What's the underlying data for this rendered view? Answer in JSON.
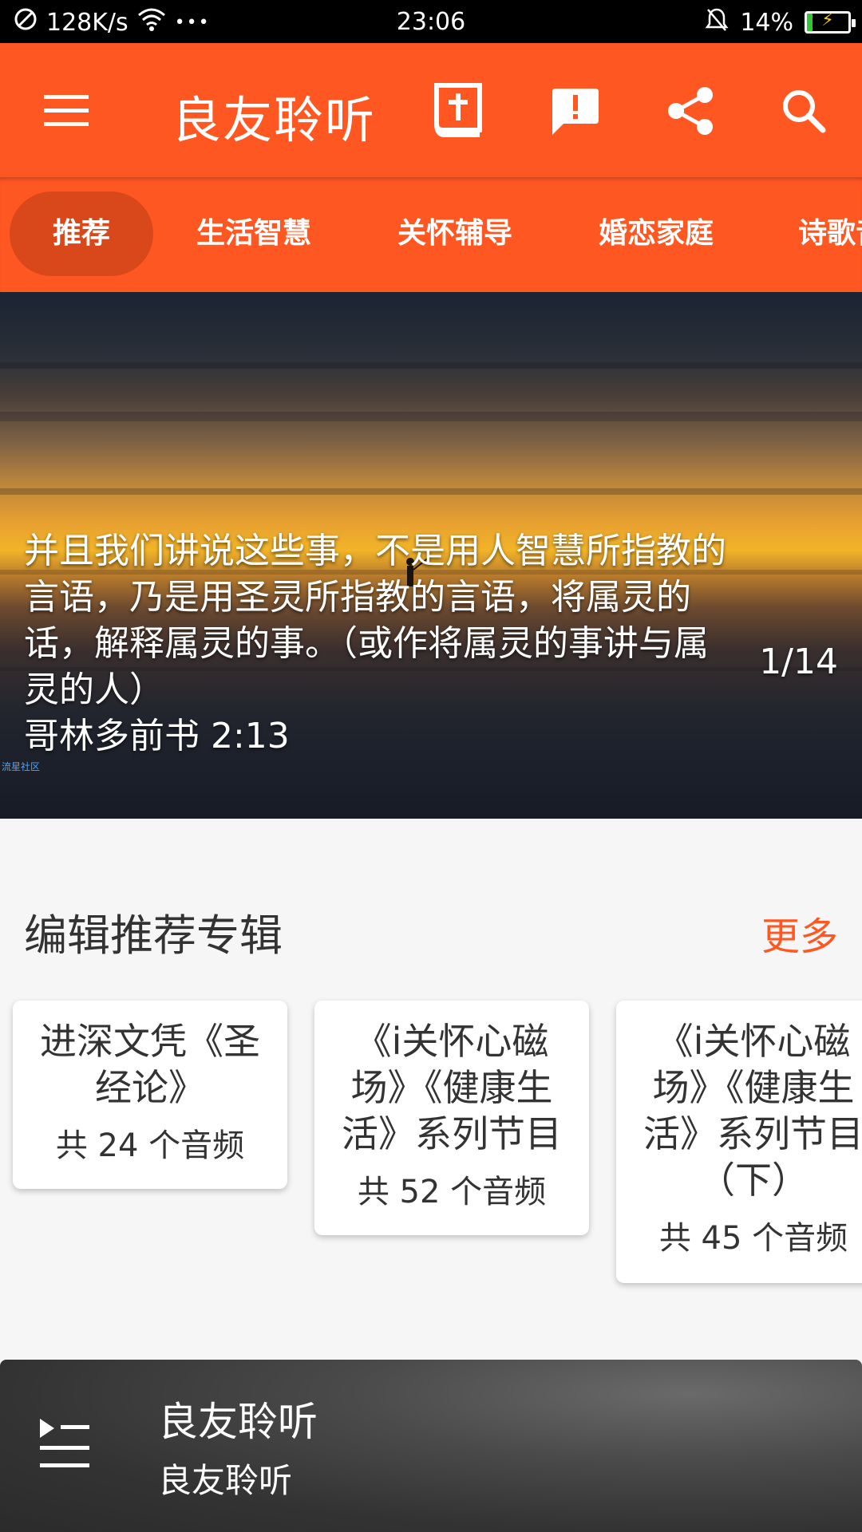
{
  "status_bar": {
    "net_speed": "128K/s",
    "more": "•••",
    "time": "23:06",
    "battery_percent": "14%",
    "battery_level": 0.14
  },
  "app_bar": {
    "title": "良友聆听",
    "icons": [
      "menu-icon",
      "bible-icon",
      "feedback-icon",
      "share-icon",
      "search-icon"
    ]
  },
  "tabs": [
    {
      "label": "推荐",
      "active": true
    },
    {
      "label": "生活智慧",
      "active": false
    },
    {
      "label": "关怀辅导",
      "active": false
    },
    {
      "label": "婚恋家庭",
      "active": false
    },
    {
      "label": "诗歌音乐",
      "active": false
    }
  ],
  "banner": {
    "verse": "并且我们讲说这些事，不是用人智慧所指教的言语，乃是用圣灵所指教的言语，将属灵的话，解释属灵的事。（或作将属灵的事讲与属灵的人）",
    "reference": "哥林多前书 2:13",
    "counter": "1/14",
    "watermark": "流星社区"
  },
  "section": {
    "title": "编辑推荐专辑",
    "more": "更多"
  },
  "albums": [
    {
      "title": "进深文凭《圣经论》",
      "count": "共 24 个音频"
    },
    {
      "title": "《i关怀心磁场》《健康生活》系列节目",
      "count": "共 52 个音频"
    },
    {
      "title": "《i关怀心磁场》《健康生活》系列节目（下）",
      "count": "共 45 个音频"
    }
  ],
  "player": {
    "title": "良友聆听",
    "subtitle": "良友聆听"
  },
  "colors": {
    "primary": "#ff5722",
    "tab_active": "#d9481a",
    "accent": "#ff5722"
  }
}
